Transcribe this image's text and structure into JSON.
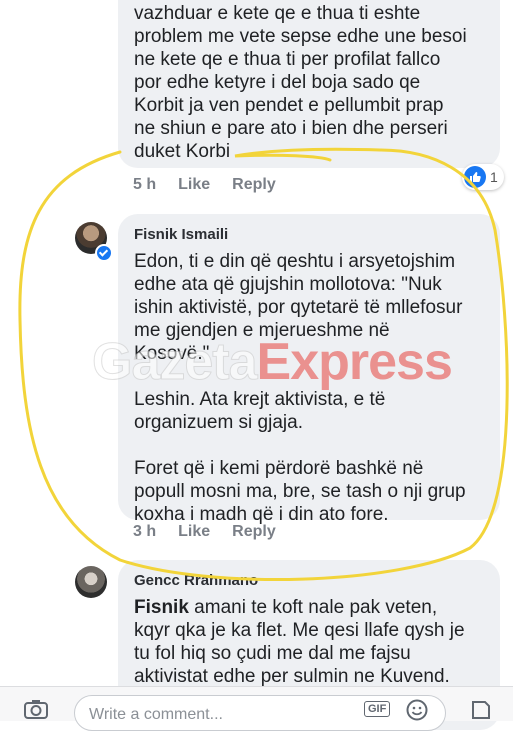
{
  "comments": [
    {
      "text": "vazhduar e kete qe e thua ti eshte\nproblem me vete sepse edhe une besoi\nne kete qe e thua ti per profilat fallco\npor edhe ketyre i del boja sado qe\nKorbit ja ven pendet e pellumbit prap\nne shiun e pare ato i bien dhe perseri\nduket Korbi",
      "time": "5 h",
      "like": "Like",
      "reply": "Reply",
      "reaction_count": "1"
    },
    {
      "author": "Fisnik Ismaili",
      "text": "Edon, ti e din që qeshtu i arsyetojshim\nedhe ata që gjujshin mollotova: \"Nuk\nishin aktivistë, por qytetarë të mllefosur\nme gjendjen e mjerueshme në\nKosovë.\"\n\nLeshin. Ata krejt aktivista, e të\norganizuem si gjaja.\n\nForet që i kemi përdorë bashkë në\npopull mosni ma, bre, se tash o nji grup\nkoxha i madh që i din ato fore.",
      "time": "3 h",
      "like": "Like",
      "reply": "Reply"
    },
    {
      "author": "Gencc Rrahmano",
      "mention": "Fisnik",
      "text": " amani te koft nale pak veten,\nkqyr qka je ka flet. Me qesi llafe qysh je\ntu fol hiq so çudi me dal me fajsu\naktivistat edhe per sulmin ne Kuvend.\nEdhe e kam kontrolluar dhe e kam stal"
    }
  ],
  "watermark": {
    "part1": "Gazeta",
    "part2": "Express"
  },
  "composer": {
    "placeholder": "Write a comment...",
    "gif_label": "GIF"
  },
  "colors": {
    "accent": "#1877f2",
    "highlight": "#f2d43a",
    "watermark_red": "#e8443f"
  },
  "icons": [
    "camera-icon",
    "gif-icon",
    "emoji-icon",
    "sticker-icon",
    "like-icon",
    "verified-badge-icon"
  ]
}
